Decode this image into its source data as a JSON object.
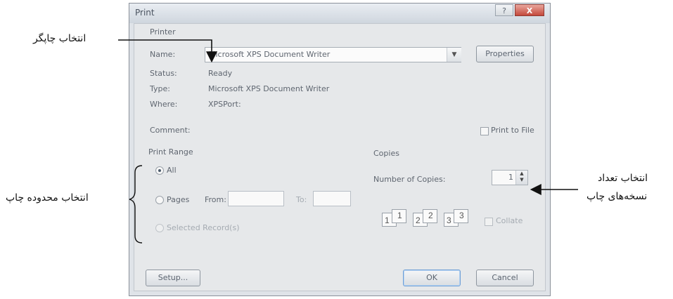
{
  "dialog": {
    "title": "Print",
    "help_glyph": "?",
    "close_glyph": "X",
    "printer_group": "Printer",
    "name_label": "Name:",
    "name_value": "Microsoft XPS Document Writer",
    "properties_button": "Properties",
    "status_label": "Status:",
    "status_value": "Ready",
    "type_label": "Type:",
    "type_value": "Microsoft XPS Document Writer",
    "where_label": "Where:",
    "where_value": "XPSPort:",
    "comment_label": "Comment:",
    "print_to_file": "Print to File",
    "range_group": "Print Range",
    "range_all": "All",
    "range_pages": "Pages",
    "from_label": "From:",
    "to_label": "To:",
    "range_selected": "Selected Record(s)",
    "copies_group": "Copies",
    "number_of_copies_label": "Number of Copies:",
    "copies_value": "1",
    "collate_label": "Collate",
    "setup_button": "Setup...",
    "ok_button": "OK",
    "cancel_button": "Cancel",
    "collate_pages": [
      {
        "a": "1",
        "b": "1"
      },
      {
        "a": "2",
        "b": "2"
      },
      {
        "a": "3",
        "b": "3"
      }
    ]
  },
  "annotations": {
    "select_printer": "انتخاب چاپگر",
    "select_range": "انتخاب محدوده چاپ",
    "select_copies_line1": "انتخاب تعداد",
    "select_copies_line2": "نسخه‌های چاپ"
  }
}
